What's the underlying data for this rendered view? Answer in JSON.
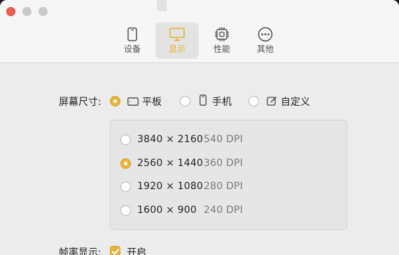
{
  "tabs": [
    {
      "label": "设备",
      "icon": "phone-icon"
    },
    {
      "label": "显示",
      "icon": "monitor-icon",
      "active": true
    },
    {
      "label": "性能",
      "icon": "chip-icon"
    },
    {
      "label": "其他",
      "icon": "more-icon"
    }
  ],
  "screen_size": {
    "label": "屏幕尺寸:",
    "options": [
      {
        "label": "平板",
        "icon": "tablet-icon",
        "selected": true
      },
      {
        "label": "手机",
        "icon": "phone-icon",
        "selected": false
      },
      {
        "label": "自定义",
        "icon": "edit-icon",
        "selected": false
      }
    ]
  },
  "resolutions": [
    {
      "res": "3840 × 2160",
      "dpi": "540 DPI",
      "selected": false
    },
    {
      "res": "2560 × 1440",
      "dpi": "360 DPI",
      "selected": true
    },
    {
      "res": "1920 × 1080",
      "dpi": "280 DPI",
      "selected": false
    },
    {
      "res": "1600 × 900",
      "dpi": "240 DPI",
      "selected": false
    }
  ],
  "fps": {
    "label": "帧率显示:",
    "checkbox_label": "开启",
    "checked": true
  },
  "colors": {
    "accent": "#e8b43a",
    "active_tab_text": "#e4b22b"
  }
}
